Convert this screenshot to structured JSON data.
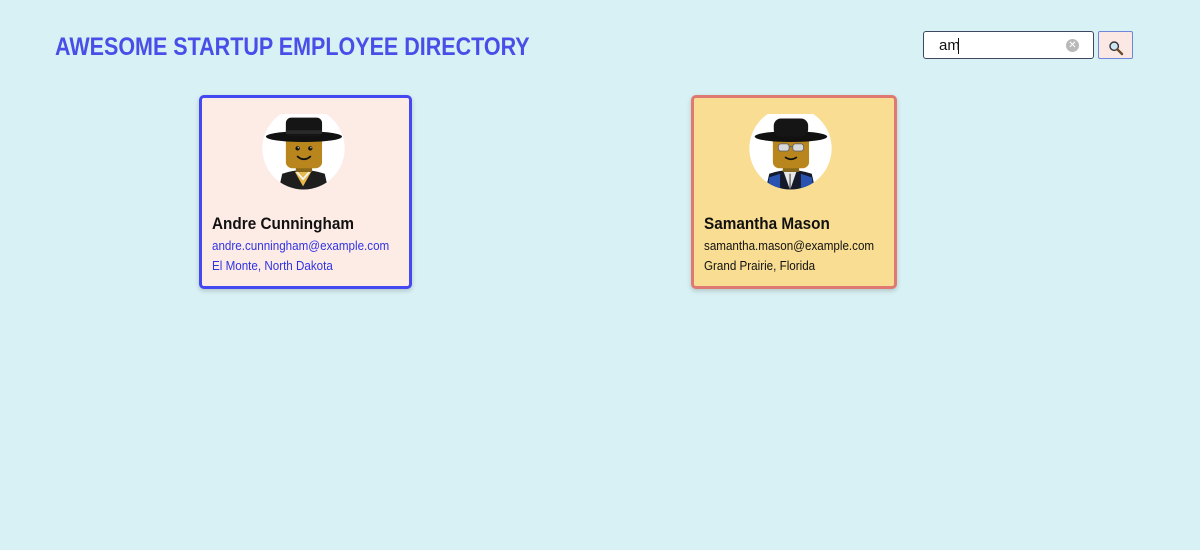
{
  "header": {
    "title": "AWESOME STARTUP EMPLOYEE DIRECTORY"
  },
  "search": {
    "value": "am",
    "placeholder": "",
    "clear_icon": "clear-icon",
    "button_icon": "search-icon"
  },
  "employees": [
    {
      "name": "Andre Cunningham",
      "email": "andre.cunningham@example.com",
      "location": "El Monte, North Dakota",
      "avatar": "lego-minifigure-hat-smiling",
      "highlighted": true
    },
    {
      "name": "Samantha Mason",
      "email": "samantha.mason@example.com",
      "location": "Grand Prairie, Florida",
      "avatar": "lego-minifigure-hat-sunglasses",
      "highlighted": false
    }
  ],
  "colors": {
    "background": "#d8f1f4",
    "title": "#4a4ee8",
    "card_highlight_border": "#4348f0",
    "card_highlight_bg": "#fdece6",
    "card_default_border": "#de7a72",
    "card_default_bg": "#f8dd93"
  }
}
